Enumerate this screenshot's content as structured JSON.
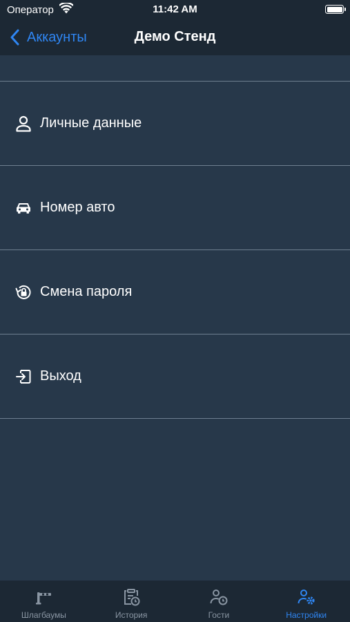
{
  "status_bar": {
    "carrier": "Оператор",
    "time": "11:42 AM"
  },
  "nav": {
    "back_label": "Аккаунты",
    "title": "Демо Стенд"
  },
  "menu": {
    "items": [
      {
        "label": "Личные данные",
        "icon": "person-icon"
      },
      {
        "label": "Номер авто",
        "icon": "car-icon"
      },
      {
        "label": "Смена пароля",
        "icon": "password-reset-icon"
      },
      {
        "label": "Выход",
        "icon": "logout-icon"
      }
    ]
  },
  "tabs": [
    {
      "label": "Шлагбаумы",
      "icon": "barrier-icon",
      "active": false
    },
    {
      "label": "История",
      "icon": "history-icon",
      "active": false
    },
    {
      "label": "Гости",
      "icon": "guests-icon",
      "active": false
    },
    {
      "label": "Настройки",
      "icon": "settings-user-icon",
      "active": true
    }
  ],
  "colors": {
    "accent": "#2f86f3",
    "background": "#27384a",
    "bars": "#1c2834",
    "separator": "#6e7f90",
    "inactive_tab": "#8a96a3"
  }
}
